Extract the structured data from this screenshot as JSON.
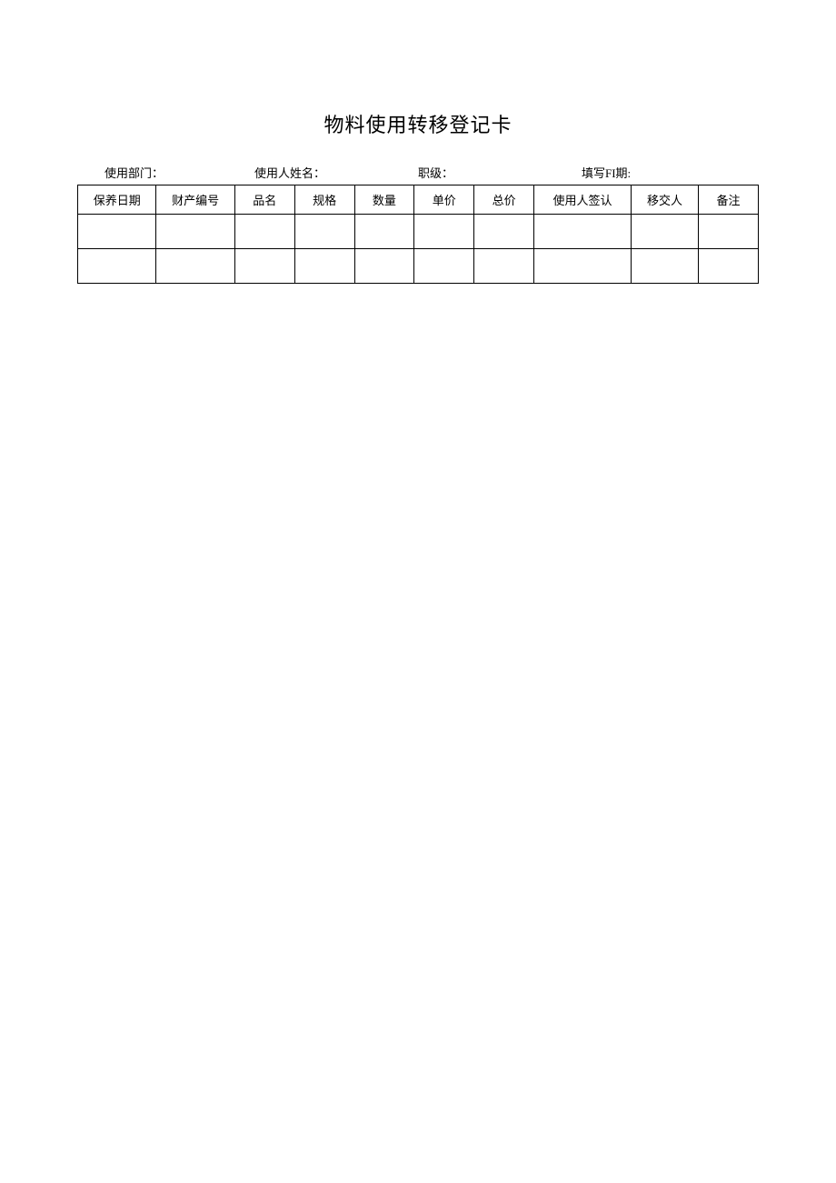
{
  "title": "物料使用转移登记卡",
  "info": {
    "dept_label": "使用部门：",
    "dept_value": "",
    "user_label": "使用人姓名：",
    "user_value": "",
    "rank_label": "职级：",
    "rank_value": "",
    "date_label": "填写FI期:",
    "date_value": ""
  },
  "headers": {
    "date": "保养日期",
    "asset_no": "财产编号",
    "name": "品名",
    "spec": "规格",
    "qty": "数量",
    "unit_price": "单价",
    "total": "总价",
    "signature": "使用人签认",
    "handover": "移交人",
    "remark": "备注"
  },
  "rows": [
    {
      "date": "",
      "asset_no": "",
      "name": "",
      "spec": "",
      "qty": "",
      "unit_price": "",
      "total": "",
      "signature": "",
      "handover": "",
      "remark": ""
    },
    {
      "date": "",
      "asset_no": "",
      "name": "",
      "spec": "",
      "qty": "",
      "unit_price": "",
      "total": "",
      "signature": "",
      "handover": "",
      "remark": ""
    }
  ]
}
